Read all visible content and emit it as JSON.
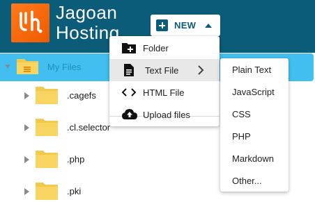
{
  "brand": {
    "line1": "Jagoan",
    "line2": "Hosting",
    "accent_color": "#f26b0f",
    "header_color": "#0b5c78"
  },
  "toolbar": {
    "new_label": "NEW"
  },
  "tree": {
    "root_label": "My Files",
    "items": [
      {
        "label": ".cagefs"
      },
      {
        "label": ".cl.selector"
      },
      {
        "label": ".php"
      },
      {
        "label": ".pki"
      }
    ]
  },
  "menu": {
    "items": [
      {
        "label": "Folder",
        "icon": "folder-plus-icon"
      },
      {
        "label": "Text File",
        "icon": "text-file-icon"
      },
      {
        "label": "HTML File",
        "icon": "code-icon"
      },
      {
        "label": "Upload files",
        "icon": "cloud-upload-icon"
      }
    ]
  },
  "submenu": {
    "items": [
      {
        "label": "Plain Text"
      },
      {
        "label": "JavaScript"
      },
      {
        "label": "CSS"
      },
      {
        "label": "PHP"
      },
      {
        "label": "Markdown"
      },
      {
        "label": "Other..."
      }
    ]
  }
}
